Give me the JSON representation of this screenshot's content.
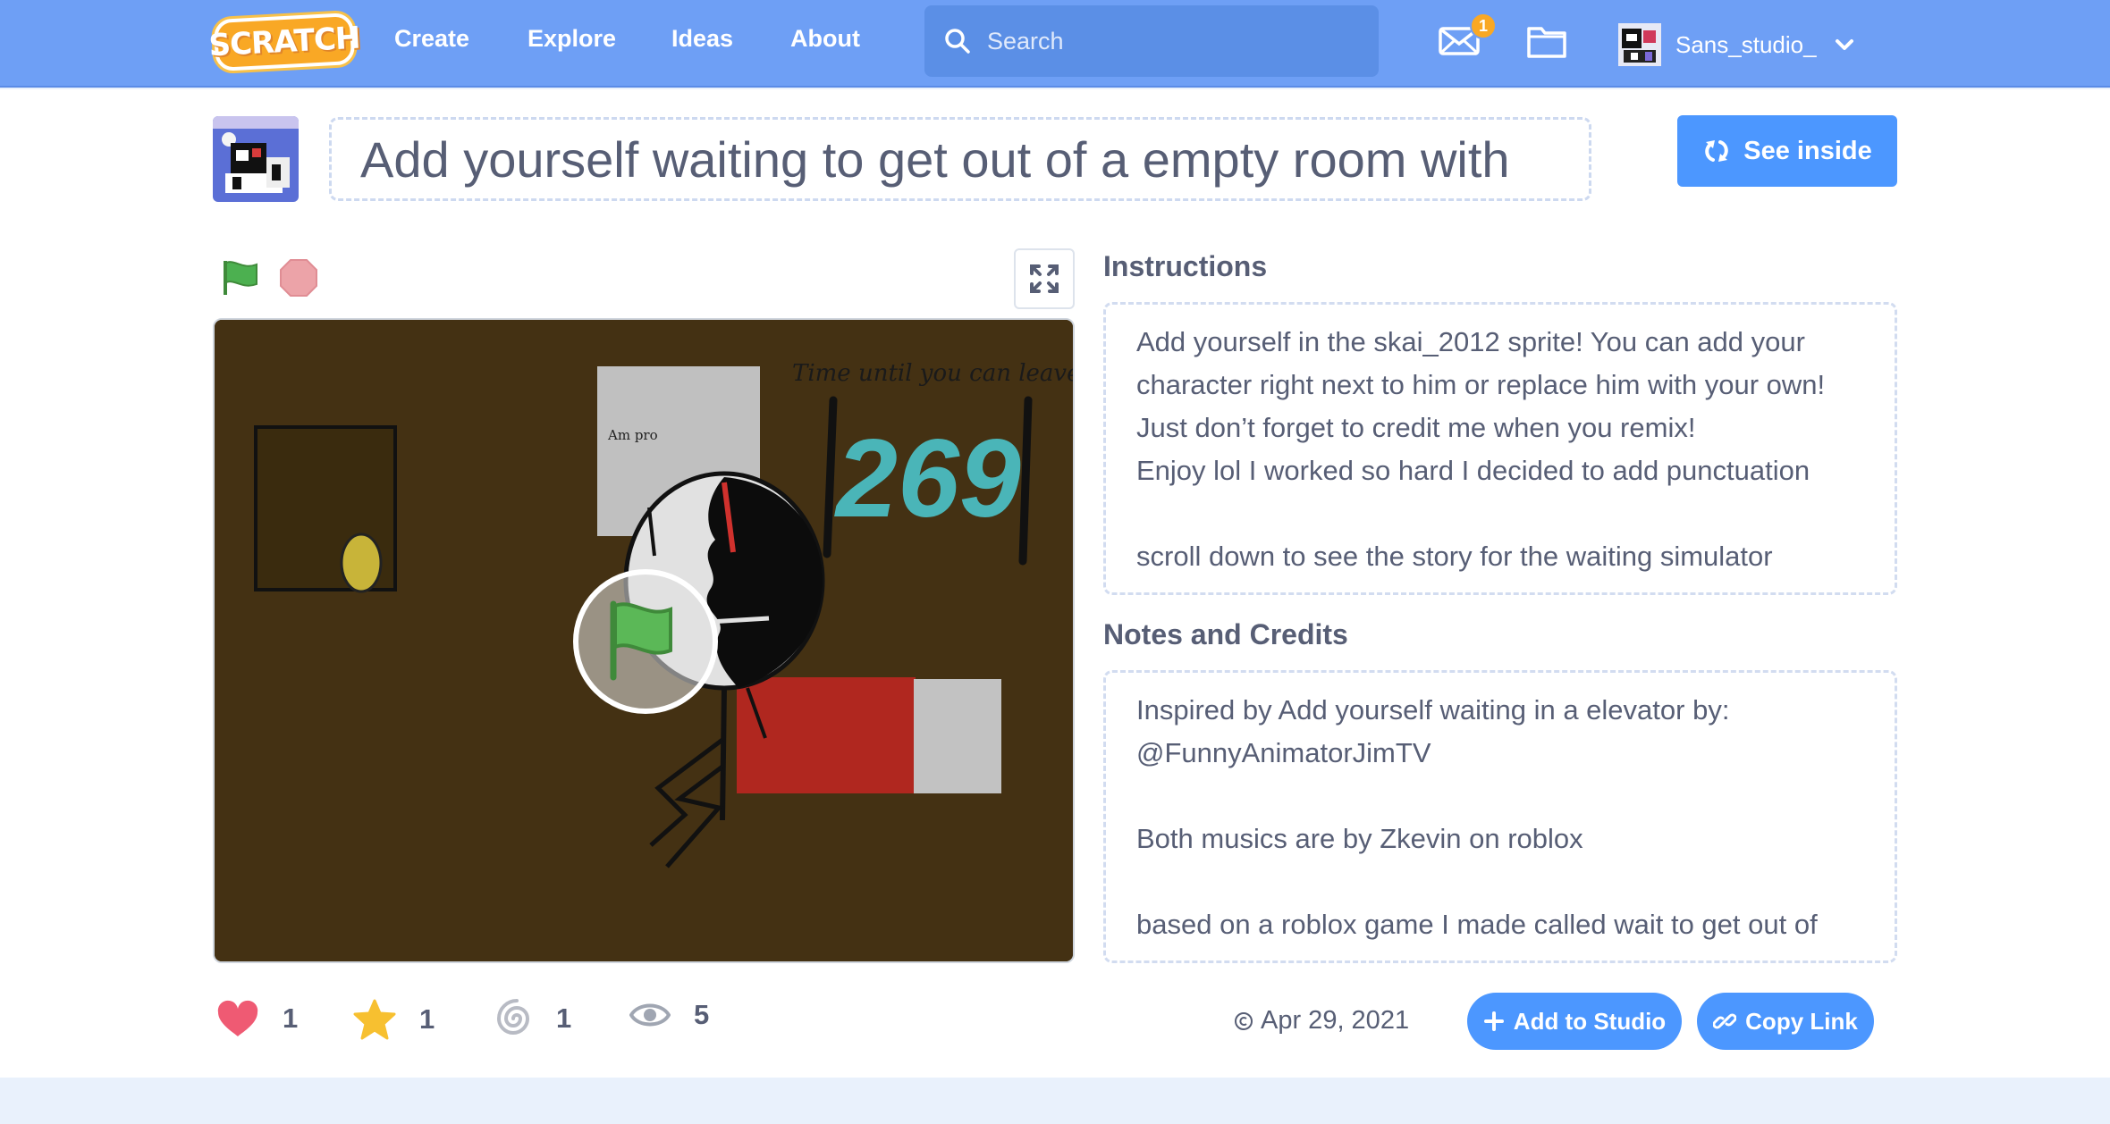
{
  "nav": {
    "logo_text": "SCRATCH",
    "links": [
      "Create",
      "Explore",
      "Ideas",
      "About"
    ],
    "search_placeholder": "Search",
    "messages_count": "1",
    "username": "Sans_studio_"
  },
  "project": {
    "title": "Add yourself waiting to get out of a empty room with",
    "see_inside_label": "See inside"
  },
  "stage": {
    "sign_text": "Am pro",
    "timer_caption": "Time until you can leave",
    "timer_value": "269"
  },
  "instructions": {
    "heading": "Instructions",
    "text": "Add yourself in the skai_2012 sprite! You can add your character right next to him or replace him with your own!\nJust don’t forget to credit me when you remix!\nEnjoy lol I worked so hard I decided to add punctuation\n\nscroll down to see the story for the waiting simulator"
  },
  "notes": {
    "heading": "Notes and Credits",
    "text": "Inspired by Add yourself waiting in a elevator by: @FunnyAnimatorJimTV\n\nBoth musics are by Zkevin on roblox\n\nbased on a roblox game I made called wait to get out of"
  },
  "stats": {
    "loves": "1",
    "favorites": "1",
    "remixes": "1",
    "views": "5"
  },
  "footer": {
    "date": "Apr 29, 2021",
    "add_to_studio_label": "Add to Studio",
    "copy_link_label": "Copy Link"
  },
  "colors": {
    "nav_blue": "#6e9ff5",
    "button_blue": "#4c97ff",
    "text_gray": "#575e75",
    "love_red": "#ef5a73",
    "star_yellow": "#f7c030",
    "stage_brown": "#443113",
    "timer_teal": "#4ab5b8"
  }
}
